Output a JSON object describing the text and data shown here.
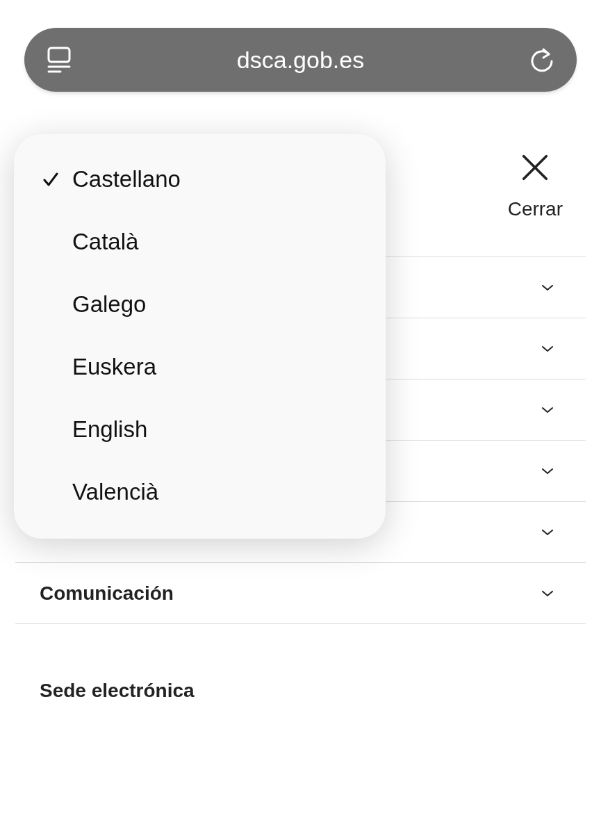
{
  "address_bar": {
    "url": "dsca.gob.es"
  },
  "close_button": {
    "label": "Cerrar"
  },
  "nav_rows": [
    {
      "expanded": false
    },
    {
      "expanded": false
    },
    {
      "expanded": false
    },
    {
      "expanded": false
    },
    {
      "expanded": false
    },
    {
      "label": "Comunicación",
      "expanded": false
    }
  ],
  "link": "Sede electrónica",
  "language_menu": [
    {
      "label": "Castellano",
      "selected": true
    },
    {
      "label": "Català",
      "selected": false
    },
    {
      "label": "Galego",
      "selected": false
    },
    {
      "label": "Euskera",
      "selected": false
    },
    {
      "label": "English",
      "selected": false
    },
    {
      "label": "Valencià",
      "selected": false
    }
  ]
}
